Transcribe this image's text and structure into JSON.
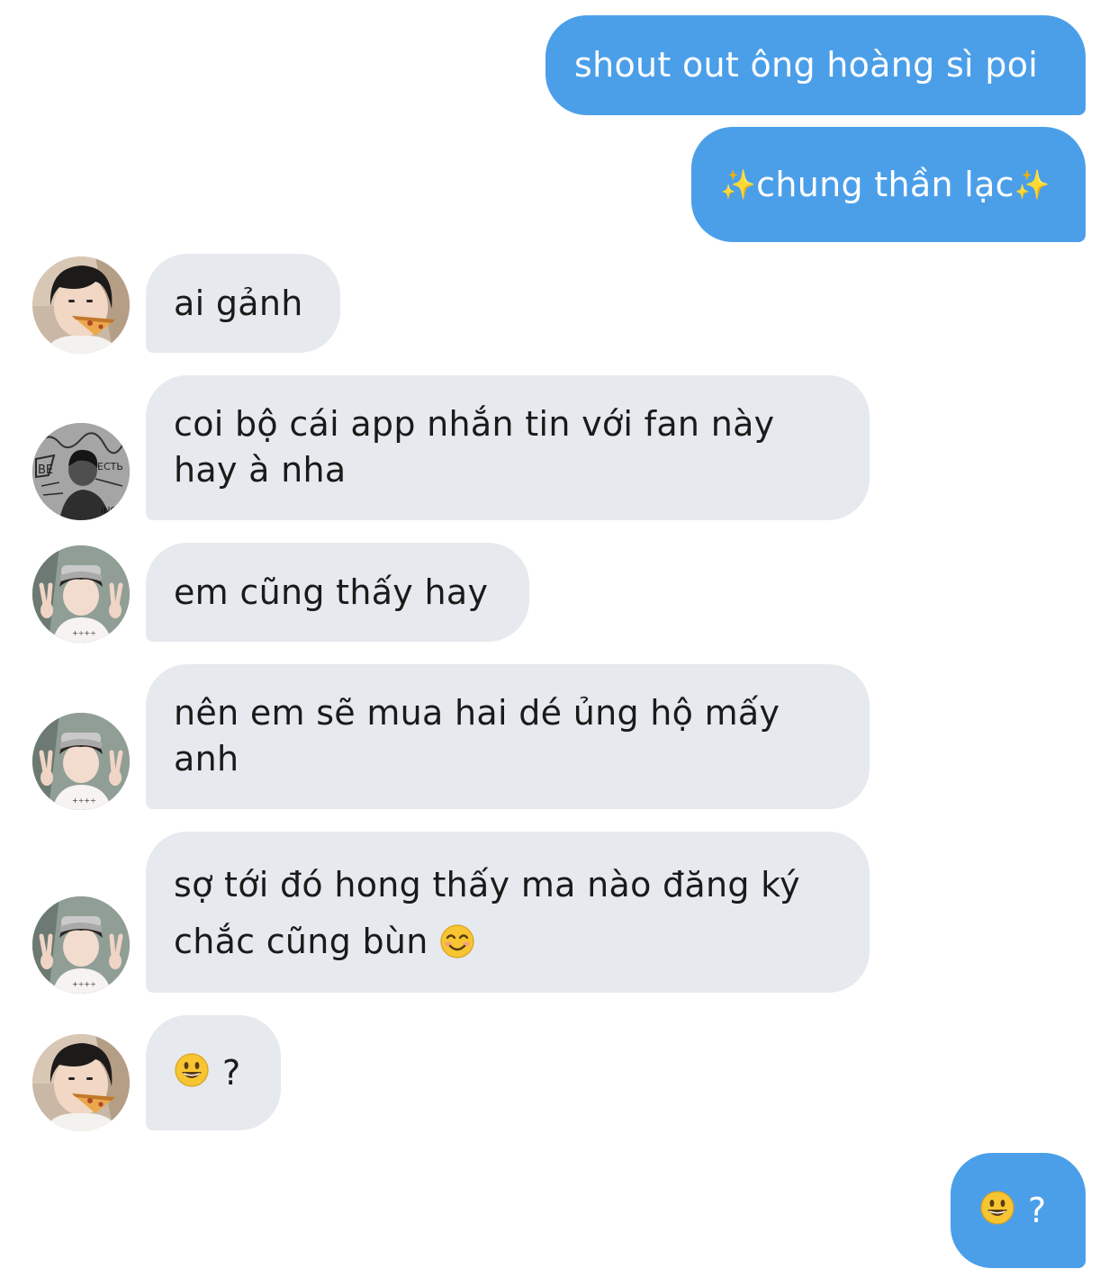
{
  "messages": [
    {
      "id": "m1",
      "side": "outgoing",
      "text": "shout out ông hoàng sì poi"
    },
    {
      "id": "m2",
      "side": "outgoing",
      "sparkle_left": "✨",
      "text": "chung thần lạc",
      "sparkle_right": "✨"
    },
    {
      "id": "m3",
      "side": "incoming",
      "avatar": "pizza-boy-avatar",
      "text": "ai gảnh"
    },
    {
      "id": "m4",
      "side": "incoming",
      "avatar": "graffiti-avatar",
      "lines": [
        "coi bộ cái app nhắn tin với fan này",
        "hay à nha"
      ]
    },
    {
      "id": "m5",
      "side": "incoming",
      "avatar": "peace-sign-avatar",
      "text": "em cũng thấy hay"
    },
    {
      "id": "m6",
      "side": "incoming",
      "avatar": "peace-sign-avatar",
      "lines": [
        "nên em sẽ mua hai dé ủng hộ mấy",
        "anh"
      ]
    },
    {
      "id": "m7",
      "side": "incoming",
      "avatar": "peace-sign-avatar",
      "lines": [
        "sợ tới đó hong thấy ma nào đăng ký",
        "chắc cũng bùn"
      ],
      "emoji": "smiling-blush-emoji"
    },
    {
      "id": "m8",
      "side": "incoming",
      "avatar": "pizza-boy-avatar",
      "emoji": "grinning-emoji",
      "text": "?"
    },
    {
      "id": "m9",
      "side": "outgoing",
      "emoji": "grinning-emoji",
      "text": "?"
    }
  ],
  "colors": {
    "outgoing_bubble": "#4b9fe9",
    "incoming_bubble": "#e6e9ee",
    "outgoing_text": "#ffffff",
    "incoming_text": "#1a1a1a"
  }
}
